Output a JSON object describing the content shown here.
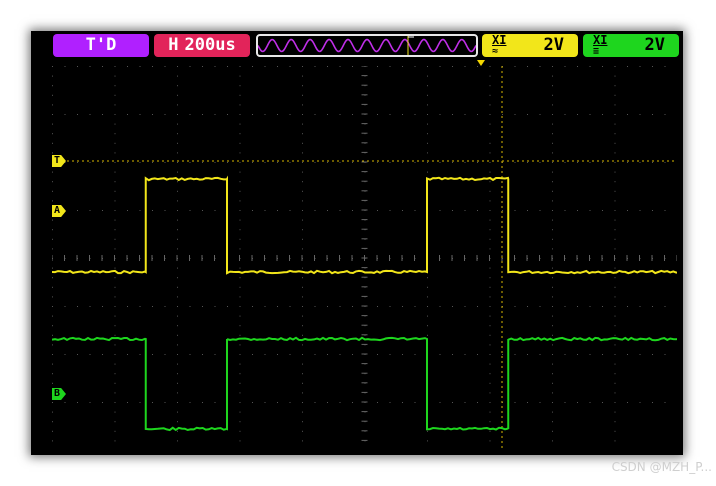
{
  "status_bar": {
    "mode": "T'D",
    "timebase": {
      "prefix": "H",
      "value": "200us"
    },
    "ch1": {
      "coupling_symbol": "XI",
      "volts_per_div": "2V"
    },
    "ch2": {
      "coupling_symbol": "XI",
      "volts_per_div": "2V"
    }
  },
  "markers": {
    "trigger": "T",
    "channel_a": "A",
    "channel_b": "B"
  },
  "colors": {
    "mode_bg": "#b020ff",
    "timebase_bg": "#e2245a",
    "ch1": "#f2e61a",
    "ch2": "#1ed61e",
    "trigger_marker": "#f2e61a",
    "grid": "#5a5a5a"
  },
  "waveforms": {
    "ch1_high_intervals_div": [
      [
        1.5,
        2.8
      ],
      [
        6.0,
        7.3
      ]
    ],
    "ch2_low_intervals_div": [
      [
        1.5,
        2.8
      ],
      [
        6.0,
        7.3
      ]
    ]
  },
  "watermark": "CSDN @MZH_P..."
}
